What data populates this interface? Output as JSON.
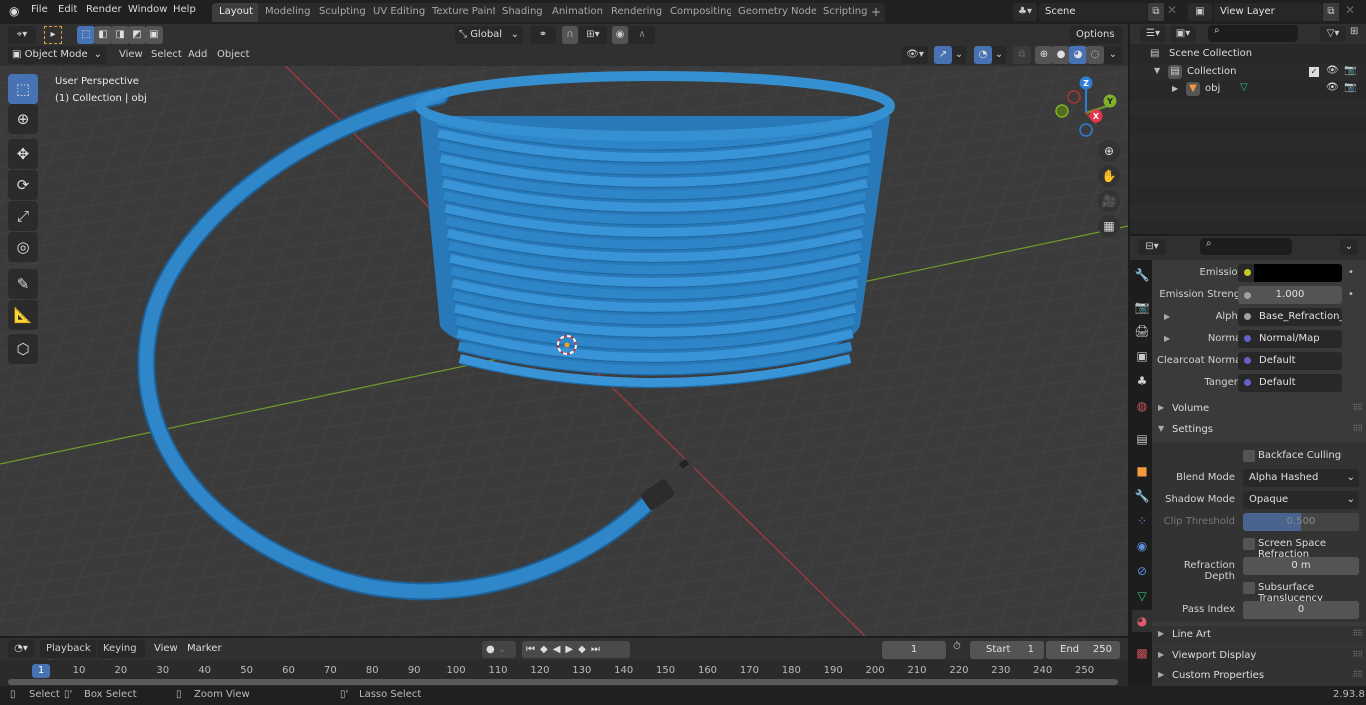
{
  "topbar": {
    "menus": [
      "File",
      "Edit",
      "Render",
      "Window",
      "Help"
    ],
    "workspaces": [
      "Layout",
      "Modeling",
      "Sculpting",
      "UV Editing",
      "Texture Paint",
      "Shading",
      "Animation",
      "Rendering",
      "Compositing",
      "Geometry Nodes",
      "Scripting"
    ],
    "active_workspace": "Layout",
    "add_workspace": "+",
    "scene": "Scene",
    "view_layer": "View Layer"
  },
  "viewport_header": {
    "mode": "Object Mode",
    "menus": [
      "View",
      "Select",
      "Add",
      "Object"
    ],
    "transform_orientation": "Global",
    "options": "Options"
  },
  "viewport": {
    "perspective": "User Perspective",
    "collection_info": "(1) Collection | obj",
    "gizmo_axes": {
      "x": "X",
      "y": "Y",
      "z": "Z"
    },
    "colors": {
      "cable": "#2f86c9",
      "x_axis": "#b0363d",
      "y_axis": "#6f9c2a",
      "z_axis": "#2d7fd6"
    }
  },
  "tools": [
    "select-box",
    "cursor",
    "move",
    "rotate",
    "scale",
    "transform",
    "annotate",
    "measure",
    "add-cube"
  ],
  "outliner": {
    "scene_collection": "Scene Collection",
    "collection": "Collection",
    "object": "obj"
  },
  "properties": {
    "rows": [
      {
        "label": "Emission",
        "value": "",
        "socket_color": "#c7c729",
        "style": "black"
      },
      {
        "label": "Emission Strengt",
        "value": "1.000",
        "socket_color": "#a1a1a1",
        "style": "number"
      },
      {
        "label": "Alpha",
        "value": "Base_Refraction_inv...",
        "socket_color": "#a1a1a1",
        "style": "link",
        "expandable": true
      },
      {
        "label": "Normal",
        "value": "Normal/Map",
        "socket_color": "#6363c7",
        "style": "link",
        "expandable": true
      },
      {
        "label": "Clearcoat Normal",
        "value": "Default",
        "socket_color": "#6363c7",
        "style": "link"
      },
      {
        "label": "Tangent",
        "value": "Default",
        "socket_color": "#6363c7",
        "style": "link"
      }
    ],
    "panels": {
      "volume": "Volume",
      "settings": "Settings",
      "line_art": "Line Art",
      "viewport_display": "Viewport Display",
      "custom_properties": "Custom Properties"
    },
    "settings": {
      "backface_culling": {
        "label": "Backface Culling",
        "checked": false
      },
      "blend_mode": {
        "label": "Blend Mode",
        "value": "Alpha Hashed"
      },
      "shadow_mode": {
        "label": "Shadow Mode",
        "value": "Opaque"
      },
      "clip_threshold": {
        "label": "Clip Threshold",
        "value": "0.500",
        "fraction": 0.5
      },
      "screen_space_refraction": {
        "label": "Screen Space Refraction",
        "checked": false
      },
      "refraction_depth": {
        "label": "Refraction Depth",
        "value": "0 m"
      },
      "subsurface_translucency": {
        "label": "Subsurface Translucency",
        "checked": false
      },
      "pass_index": {
        "label": "Pass Index",
        "value": "0"
      }
    }
  },
  "timeline": {
    "menus": [
      "Playback",
      "Keying",
      "View",
      "Marker"
    ],
    "current_frame": "1",
    "start_label": "Start",
    "start": "1",
    "end_label": "End",
    "end": "250",
    "ticks": [
      "10",
      "20",
      "30",
      "40",
      "50",
      "60",
      "70",
      "80",
      "90",
      "100",
      "110",
      "120",
      "130",
      "140",
      "150",
      "160",
      "170",
      "180",
      "190",
      "200",
      "210",
      "220",
      "230",
      "240",
      "250"
    ],
    "playhead": "1"
  },
  "statusbar": {
    "select": "Select",
    "box_select": "Box Select",
    "zoom_view": "Zoom View",
    "lasso_select": "Lasso Select",
    "version": "2.93.8"
  }
}
